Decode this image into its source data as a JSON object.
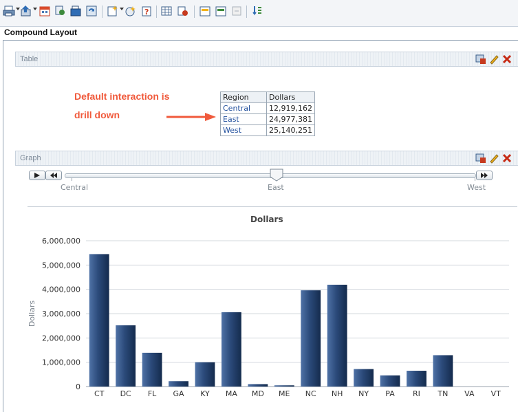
{
  "toolbar": {
    "buttons": [
      "print-icon",
      "export-icon",
      "calendar-grid-icon",
      "analysis-icon",
      "copy-icon",
      "refresh-icon",
      "new-view-icon",
      "properties-icon",
      "help-icon",
      "data-table-icon",
      "filter-icon",
      "insert-icon",
      "settings-icon",
      "disabled-icon",
      "sort-icon"
    ]
  },
  "layout": {
    "title": "Compound Layout"
  },
  "table_view": {
    "header": "Table",
    "annotation_line1": "Default interaction is",
    "annotation_line2": "drill down",
    "columns": [
      "Region",
      "Dollars"
    ],
    "rows": [
      {
        "region": "Central",
        "dollars": "12,919,162"
      },
      {
        "region": "East",
        "dollars": "24,977,381"
      },
      {
        "region": "West",
        "dollars": "25,140,251"
      }
    ]
  },
  "graph_view": {
    "header": "Graph",
    "slider": {
      "labels": [
        "Central",
        "East",
        "West"
      ],
      "selected": "East"
    }
  },
  "chart_data": {
    "type": "bar",
    "title": "Dollars",
    "xlabel": "",
    "ylabel": "Dollars",
    "ylim": [
      0,
      6000000
    ],
    "yticks": [
      "0",
      "1,000,000",
      "2,000,000",
      "3,000,000",
      "4,000,000",
      "5,000,000",
      "6,000,000"
    ],
    "categories": [
      "CT",
      "DC",
      "FL",
      "GA",
      "KY",
      "MA",
      "MD",
      "ME",
      "NC",
      "NH",
      "NY",
      "PA",
      "RI",
      "TN",
      "VA",
      "VT"
    ],
    "values": [
      5450000,
      2520000,
      1390000,
      220000,
      1000000,
      3060000,
      100000,
      50000,
      3960000,
      4190000,
      720000,
      460000,
      650000,
      1290000,
      0,
      0
    ],
    "grid": true,
    "bar_color": "#2b4a7a"
  }
}
